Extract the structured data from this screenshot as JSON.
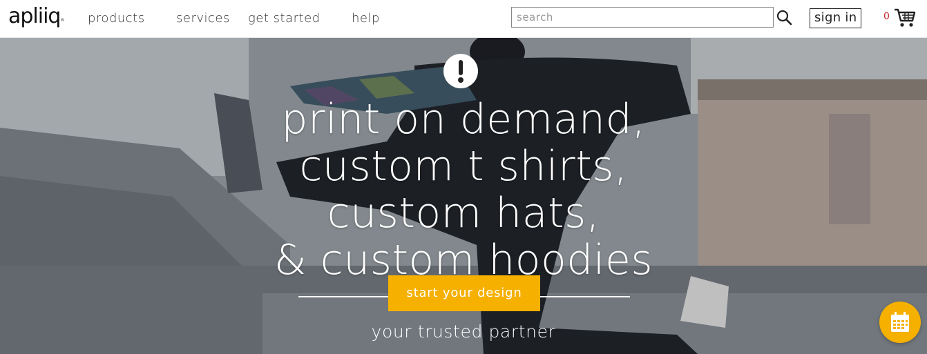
{
  "header": {
    "logo_text": "apliiq",
    "nav": [
      {
        "label": "products"
      },
      {
        "label": "services"
      },
      {
        "label": "get started"
      },
      {
        "label": "help"
      }
    ],
    "search": {
      "placeholder": "search",
      "value": ""
    },
    "sign_in_label": "sign in",
    "cart_count": "0",
    "icons": {
      "search": "search-icon",
      "cart": "cart-icon"
    }
  },
  "hero": {
    "badge_icon": "exclamation-icon",
    "headline_lines": [
      "print on demand,",
      "custom t shirts,",
      "custom hats,",
      "& custom hoodies"
    ],
    "cta_label": "start your design",
    "tagline": "your trusted partner"
  },
  "floating": {
    "calendar_icon": "calendar-icon"
  },
  "colors": {
    "accent": "#f5b000",
    "cart_count": "#c62828",
    "headline": "#ffffff"
  }
}
